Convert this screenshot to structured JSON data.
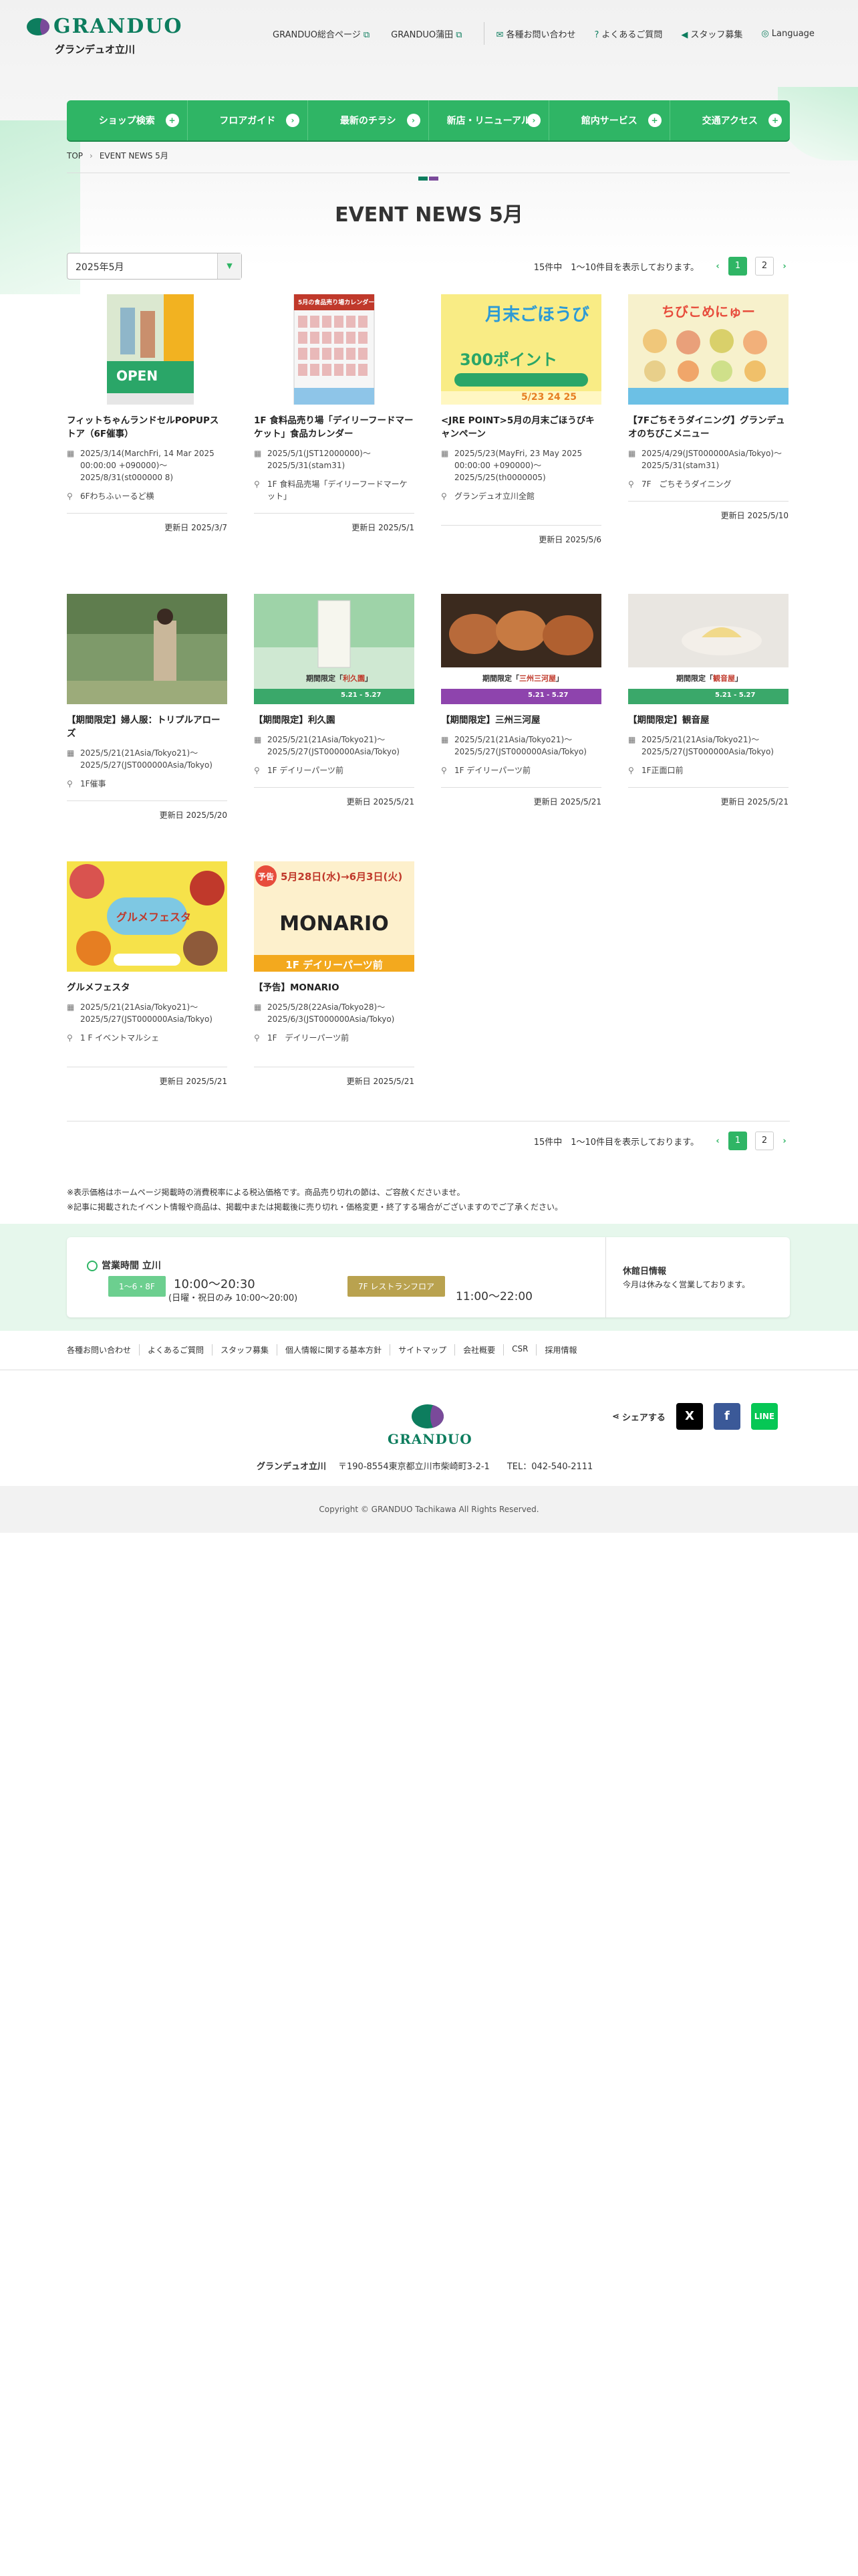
{
  "header": {
    "logo_text": "GRANDUO",
    "store_name": "グランデュオ立川",
    "links": [
      {
        "label": "GRANDUO総合ページ",
        "icon": "external-link-icon"
      },
      {
        "label": "GRANDUO蒲田",
        "icon": "external-link-icon"
      },
      {
        "label": "各種お問い合わせ",
        "icon": "mail-icon"
      },
      {
        "label": "よくあるご質問",
        "icon": "question-icon"
      },
      {
        "label": "スタッフ募集",
        "icon": "megaphone-icon"
      },
      {
        "label": "Language",
        "icon": "globe-icon"
      }
    ]
  },
  "global_nav": [
    "ショップ検索",
    "フロアガイド",
    "最新のチラシ",
    "新店・リニューアル",
    "館内サービス",
    "交通アクセス"
  ],
  "breadcrumb": [
    "TOP",
    "EVENT NEWS 5月"
  ],
  "page_title": "EVENT NEWS 5月",
  "month_select": "2025年5月",
  "pagination": {
    "count_text": "15件中　1〜10件目を表示しております。",
    "pages": [
      "1",
      "2"
    ],
    "current": "1"
  },
  "events": [
    {
      "title": "フィットちゃんランドセルPOPUPストア（6F催事）",
      "date": "2025/3/14(MarchFri, 14 Mar 2025 00:00:00 +090000)〜2025/8/31(st000000 8)",
      "place": "6Fわちふぃーるど横",
      "updated": "更新日 2025/3/7"
    },
    {
      "title": "1F 食料品売り場「デイリーフードマーケット」食品カレンダー",
      "date": "2025/5/1(JST12000000)〜2025/5/31(stam31)",
      "place": "1F 食料品売場「デイリーフードマーケット」",
      "updated": "更新日 2025/5/1"
    },
    {
      "title": "<JRE POINT>5月の月末ごほうびキャンペーン",
      "date": "2025/5/23(MayFri, 23 May 2025 00:00:00 +090000)〜2025/5/25(th0000005)",
      "place": "グランデュオ立川全館",
      "updated": "更新日 2025/5/6"
    },
    {
      "title": "【7Fごちそうダイニング】グランデュオのちびこメニュー",
      "date": "2025/4/29(JST000000Asia/Tokyo)〜2025/5/31(stam31)",
      "place": "7F　ごちそうダイニング",
      "updated": "更新日 2025/5/10"
    },
    {
      "title": "【期間限定】婦人服：トリプルアローズ",
      "date": "2025/5/21(21Asia/Tokyo21)〜2025/5/27(JST000000Asia/Tokyo)",
      "place": "1F催事",
      "updated": "更新日 2025/5/20"
    },
    {
      "title": "【期間限定】利久園",
      "date": "2025/5/21(21Asia/Tokyo21)〜2025/5/27(JST000000Asia/Tokyo)",
      "place": "1F デイリーパーツ前",
      "updated": "更新日 2025/5/21"
    },
    {
      "title": "【期間限定】三州三河屋",
      "date": "2025/5/21(21Asia/Tokyo21)〜2025/5/27(JST000000Asia/Tokyo)",
      "place": "1F デイリーパーツ前",
      "updated": "更新日 2025/5/21"
    },
    {
      "title": "【期間限定】観音屋",
      "date": "2025/5/21(21Asia/Tokyo21)〜2025/5/27(JST000000Asia/Tokyo)",
      "place": "1F正面口前",
      "updated": "更新日 2025/5/21"
    },
    {
      "title": "グルメフェスタ",
      "date": "2025/5/21(21Asia/Tokyo21)〜2025/5/27(JST000000Asia/Tokyo)",
      "place": "1 F イベントマルシェ",
      "updated": "更新日 2025/5/21"
    },
    {
      "title": "【予告】MONARIO",
      "date": "2025/5/28(22Asia/Tokyo28)〜2025/6/3(JST000000Asia/Tokyo)",
      "place": "1F　デイリーパーツ前",
      "updated": "更新日 2025/5/21"
    }
  ],
  "thumb_text": {
    "fit_open": "OPEN",
    "calendar_title": "5月の食品売り場カレンダー",
    "jre_title": "月末ごほうび",
    "jre_points": "300ポイント",
    "jre_dates": "5/23 24 25",
    "chibi_title": "ちびこめにゅー",
    "limited": "期間限定",
    "rikyu_label": "利久園",
    "mikawa_label": "三州三河屋",
    "kannon_label": "観音屋",
    "date_range": "5.21 - 5.27",
    "gourmet_title": "グルメフェスタ",
    "monario_notice": "予告",
    "monario_dates": "5月28日(水)→6月3日(火)",
    "monario_name": "MONARIO",
    "monario_place": "1F デイリーパーツ前"
  },
  "notes": [
    "※表示価格はホームページ掲載時の消費税率による税込価格です。商品売り切れの節は、ご容赦くださいませ。",
    "※記事に掲載されたイベント情報や商品は、掲載中または掲載後に売り切れ・価格変更・終了する場合がございますのでご了承ください。"
  ],
  "hours": {
    "label": "営業時間 立川",
    "floor1": "1〜6・8F",
    "time1": "10:00〜20:30",
    "time1_sub": "(日曜・祝日のみ 10:00〜20:00)",
    "floor2": "7F レストランフロア",
    "time2": "11:00〜22:00",
    "closed_title": "休館日情報",
    "closed_text": "今月は休みなく営業しております。"
  },
  "footer_links": [
    "各種お問い合わせ",
    "よくあるご質問",
    "スタッフ募集",
    "個人情報に関する基本方針",
    "サイトマップ",
    "会社概要",
    "CSR",
    "採用情報"
  ],
  "footer": {
    "brand": "GRANDUO",
    "name": "グランデュオ立川",
    "address": "〒190-8554東京都立川市柴崎町3-2-1",
    "tel": "TEL：042-540-2111",
    "share_label": "シェアする",
    "copyright": "Copyright © GRANDUO Tachikawa All Rights Reserved."
  },
  "colors": {
    "brand_green": "#2fb565",
    "logo_green": "#0d7d5e",
    "logo_purple": "#7a4a9a",
    "hours_band": "#e6f7ec"
  }
}
